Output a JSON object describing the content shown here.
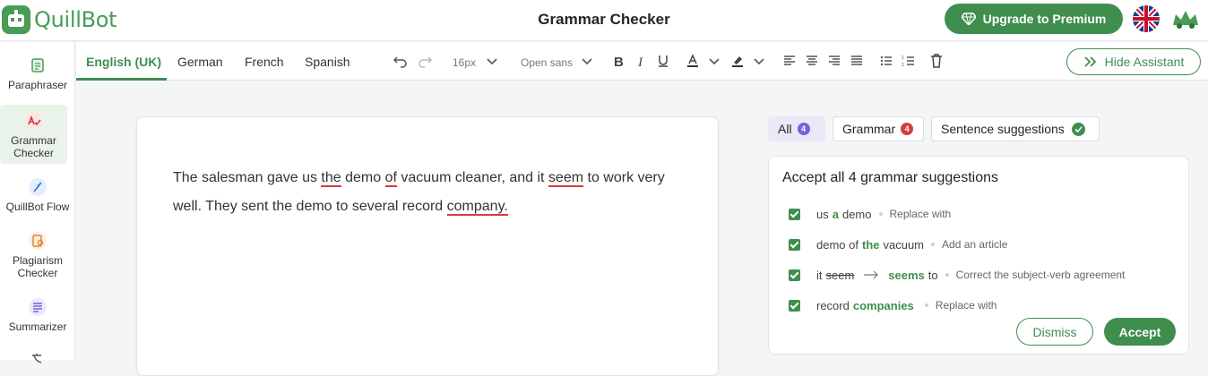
{
  "app": {
    "logo_text": "QuillBot",
    "page_title": "Grammar Checker",
    "upgrade_label": "Upgrade to Premium"
  },
  "sidebar": {
    "items": [
      {
        "label": "Paraphraser",
        "icon": "paraphraser-icon"
      },
      {
        "label": "Grammar Checker",
        "icon": "grammar-checker-icon"
      },
      {
        "label": "QuillBot Flow",
        "icon": "quillbot-flow-icon"
      },
      {
        "label": "Plagiarism Checker",
        "icon": "plagiarism-checker-icon"
      },
      {
        "label": "Summarizer",
        "icon": "summarizer-icon"
      }
    ]
  },
  "toolbar": {
    "tabs": [
      "English (UK)",
      "German",
      "French",
      "Spanish"
    ],
    "font_size": "16px",
    "font_family": "Open sans",
    "hide_assistant_label": "Hide Assistant"
  },
  "editor": {
    "segments": [
      "The salesman gave us ",
      "the",
      " demo ",
      "of",
      " vacuum cleaner, and it ",
      "seem",
      " to work very well. They sent the demo to several record ",
      "company."
    ]
  },
  "filters": {
    "all_label": "All",
    "all_count": "4",
    "grammar_label": "Grammar",
    "grammar_count": "4",
    "sentence_label": "Sentence suggestions"
  },
  "panel": {
    "title": "Accept all 4 grammar suggestions",
    "suggestions": [
      {
        "before": "us",
        "highlight": "a",
        "after": "demo",
        "hint": "Replace with"
      },
      {
        "before": "demo of",
        "highlight": "the",
        "after": "vacuum",
        "hint": "Add an article"
      },
      {
        "before": "it",
        "removed": "seem",
        "highlight": "seems",
        "after": "to",
        "hint": "Correct the subject-verb agreement"
      },
      {
        "before": "record",
        "highlight": "companies",
        "after": "",
        "hint": "Replace with"
      }
    ],
    "dismiss_label": "Dismiss",
    "accept_label": "Accept"
  },
  "colors": {
    "brand": "#3f8e4e",
    "error": "#d63c3c",
    "all_badge": "#7b5fe0",
    "grammar_badge": "#d63c3c"
  }
}
